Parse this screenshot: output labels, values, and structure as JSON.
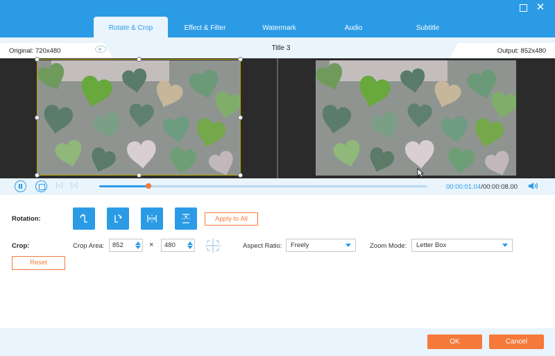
{
  "window": {
    "maximize_icon": "maximize-icon",
    "close_icon": "close-icon",
    "close_glyph": "✕"
  },
  "tabs": [
    {
      "label": "Rotate & Crop",
      "active": true
    },
    {
      "label": "Effect & Filter"
    },
    {
      "label": "Watermark"
    },
    {
      "label": "Audio"
    },
    {
      "label": "Subtitle"
    }
  ],
  "info": {
    "original": "Original: 720x480",
    "title": "Title 3",
    "output": "Output: 852x480"
  },
  "player": {
    "current_time": "00:00:01.04",
    "total_time": "/00:00:08.00",
    "progress": 0.15
  },
  "rotation": {
    "label": "Rotation:",
    "apply_all": "Apply to All"
  },
  "crop": {
    "label": "Crop:",
    "area_label": "Crop Area:",
    "width": "852",
    "times": "×",
    "height": "480",
    "aspect_label": "Aspect Ratio:",
    "aspect_value": "Freely",
    "zoom_label": "Zoom Mode:",
    "zoom_value": "Letter Box",
    "reset": "Reset"
  },
  "footer": {
    "ok": "OK",
    "cancel": "Cancel"
  },
  "colors": {
    "accent": "#2b9be6",
    "orange": "#f5793a",
    "panel": "#e9f4fd",
    "preview_bg": "#2b2b2b"
  }
}
